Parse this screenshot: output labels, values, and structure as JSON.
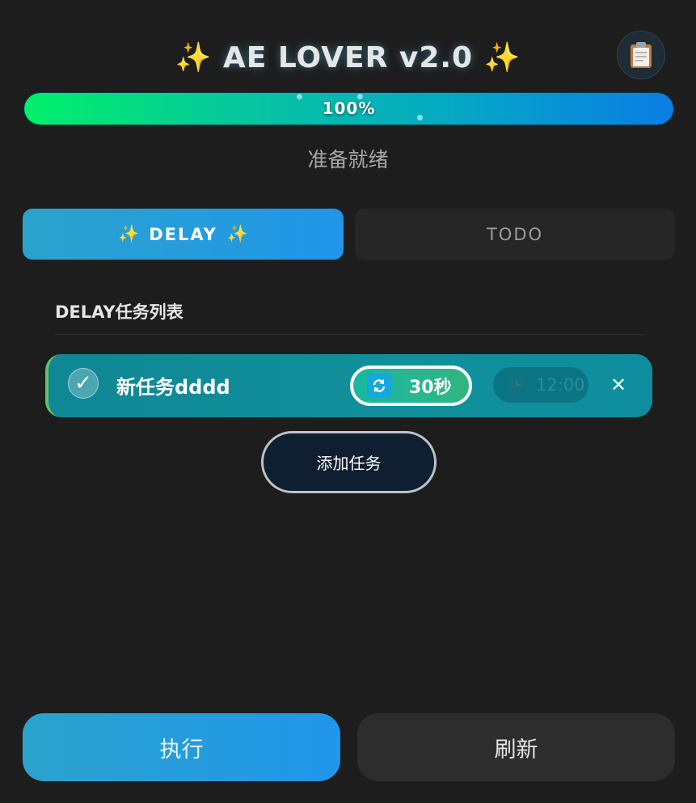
{
  "header": {
    "sparkle_left": "✨",
    "title": "AE LOVER v2.0",
    "sparkle_right": "✨",
    "clipboard_icon": "clipboard-icon"
  },
  "progress": {
    "value_percent": 100,
    "label": "100%",
    "status": "准备就绪"
  },
  "tabs": [
    {
      "label": "DELAY",
      "sparkle": "✨",
      "active": true
    },
    {
      "label": "TODO",
      "active": false
    }
  ],
  "section": {
    "title": "DELAY任务列表"
  },
  "tasks": [
    {
      "checked": true,
      "check_glyph": "✓",
      "name": "新任务dddd",
      "interval_icon": "refresh-icon",
      "interval": "30秒",
      "time_icon": "clock-icon",
      "time": "12:00",
      "delete_glyph": "✕"
    }
  ],
  "add_task_label": "添加任务",
  "footer": {
    "run_label": "执行",
    "refresh_label": "刷新"
  },
  "colors": {
    "background": "#1d1d1d",
    "accent_blue": "#2196ea",
    "progress_start": "#00f06a",
    "progress_end": "#0b7de4",
    "task_bg": "#0f8795",
    "interval_bg": "#31b580"
  }
}
